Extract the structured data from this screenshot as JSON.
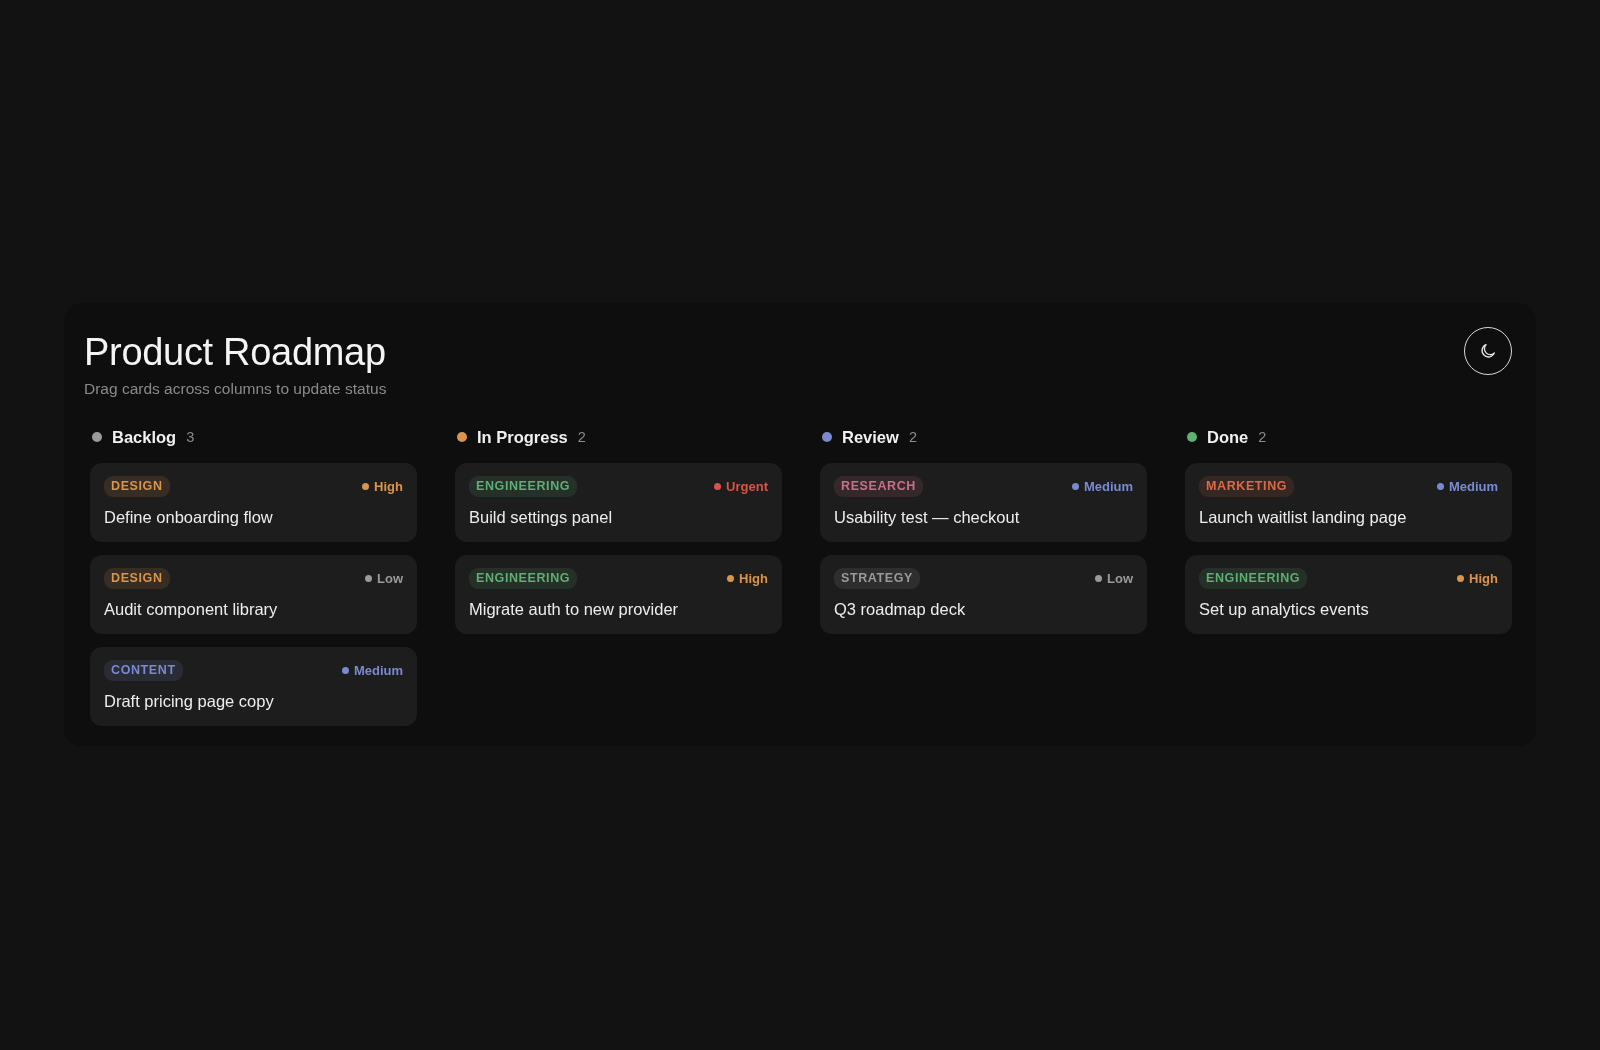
{
  "board": {
    "title": "Product Roadmap",
    "subtitle": "Drag cards across columns to update status",
    "theme_toggle": {
      "kind": "moon"
    },
    "columns": [
      {
        "name": "Backlog",
        "count": "3",
        "color": "#9a9a9a",
        "cards": [
          {
            "tag": {
              "label": "DESIGN",
              "color": "#d9954a"
            },
            "priority": {
              "label": "High",
              "color": "#d9954a"
            },
            "title": "Define onboarding flow"
          },
          {
            "tag": {
              "label": "DESIGN",
              "color": "#d9954a"
            },
            "priority": {
              "label": "Low",
              "color": "#9a9a9a"
            },
            "title": "Audit component library"
          },
          {
            "tag": {
              "label": "CONTENT",
              "color": "#7b8ad0"
            },
            "priority": {
              "label": "Medium",
              "color": "#7b8ad0"
            },
            "title": "Draft pricing page copy"
          }
        ]
      },
      {
        "name": "In Progress",
        "count": "2",
        "color": "#d9954a",
        "cards": [
          {
            "tag": {
              "label": "ENGINEERING",
              "color": "#5fae72"
            },
            "priority": {
              "label": "Urgent",
              "color": "#d9534a"
            },
            "title": "Build settings panel"
          },
          {
            "tag": {
              "label": "ENGINEERING",
              "color": "#5fae72"
            },
            "priority": {
              "label": "High",
              "color": "#d9954a"
            },
            "title": "Migrate auth to new provider"
          }
        ]
      },
      {
        "name": "Review",
        "count": "2",
        "color": "#7b8ad0",
        "cards": [
          {
            "tag": {
              "label": "RESEARCH",
              "color": "#c8708a"
            },
            "priority": {
              "label": "Medium",
              "color": "#7b8ad0"
            },
            "title": "Usability test — checkout"
          },
          {
            "tag": {
              "label": "STRATEGY",
              "color": "#9a9a9a"
            },
            "priority": {
              "label": "Low",
              "color": "#9a9a9a"
            },
            "title": "Q3 roadmap deck"
          }
        ]
      },
      {
        "name": "Done",
        "count": "2",
        "color": "#5fae72",
        "cards": [
          {
            "tag": {
              "label": "MARKETING",
              "color": "#d96a4a"
            },
            "priority": {
              "label": "Medium",
              "color": "#7b8ad0"
            },
            "title": "Launch waitlist landing page"
          },
          {
            "tag": {
              "label": "ENGINEERING",
              "color": "#5fae72"
            },
            "priority": {
              "label": "High",
              "color": "#d9954a"
            },
            "title": "Set up analytics events"
          }
        ]
      }
    ]
  }
}
